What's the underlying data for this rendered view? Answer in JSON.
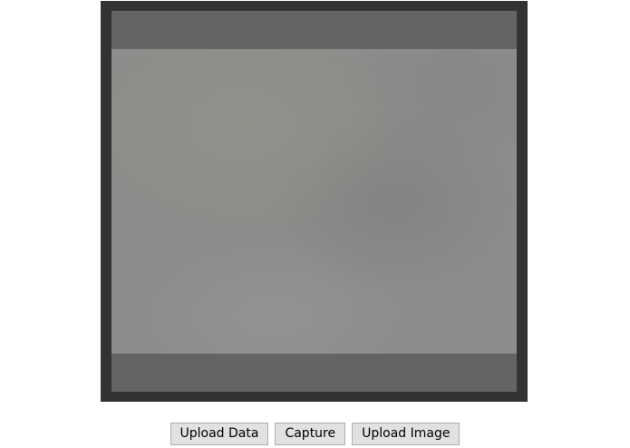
{
  "buttons": {
    "upload_data": "Upload Data",
    "capture": "Capture",
    "upload_image": "Upload Image"
  },
  "colors": {
    "frame": "#333333",
    "letterbox": "#646464",
    "feed": "#8c8c8a",
    "button_bg": "#e1e1e1",
    "button_border": "#adadad"
  }
}
